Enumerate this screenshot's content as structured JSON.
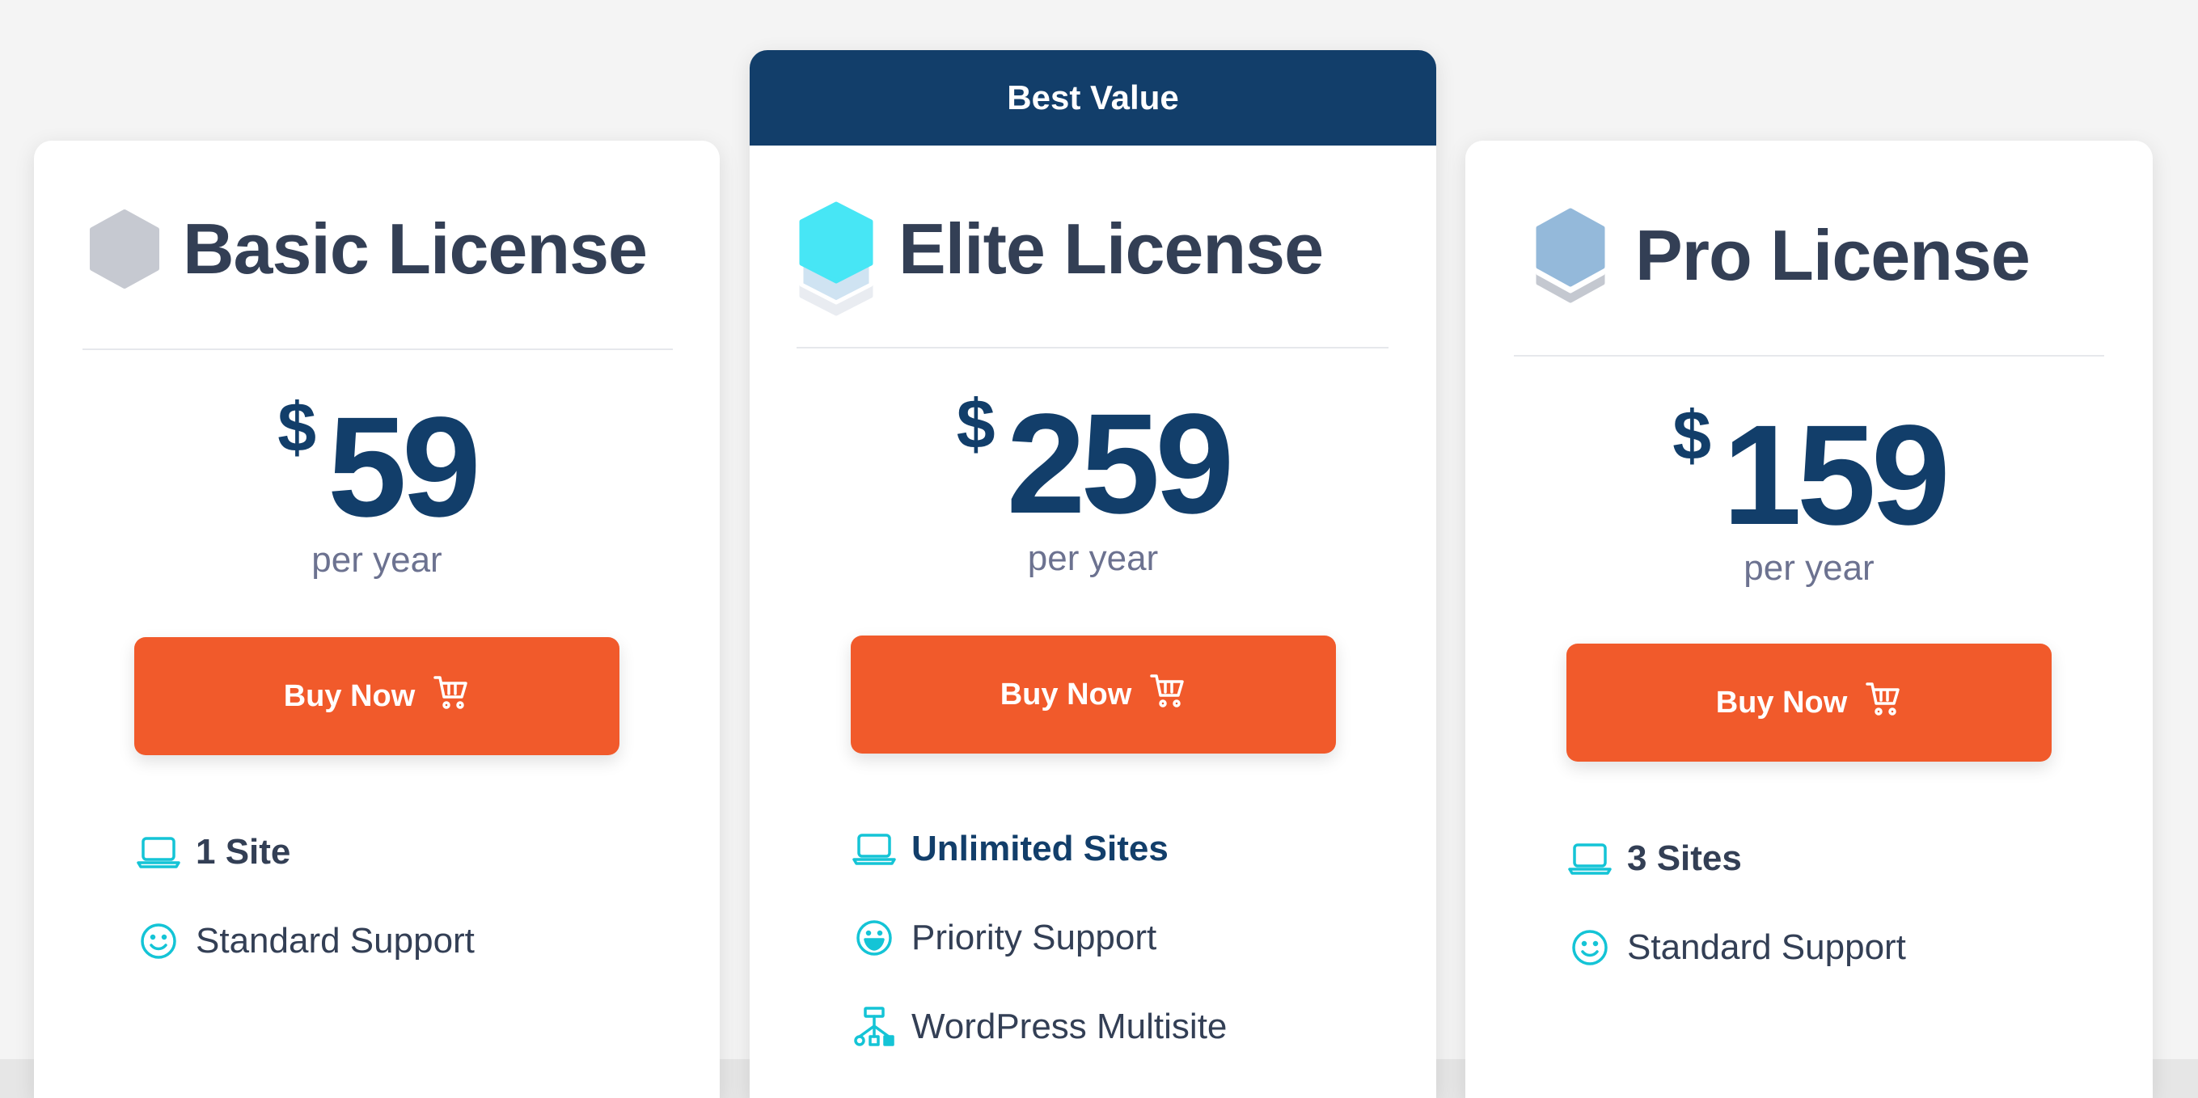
{
  "plans": [
    {
      "id": "basic",
      "name": "Basic License",
      "currency": "$",
      "price": "59",
      "period": "per year",
      "button": "Buy Now",
      "icon": "hexagon-gray-icon",
      "features": [
        {
          "icon": "laptop-icon",
          "text": "1 Site"
        },
        {
          "icon": "smile-icon",
          "text": "Standard Support"
        }
      ]
    },
    {
      "id": "elite",
      "badge": "Best Value",
      "name": "Elite License",
      "currency": "$",
      "price": "259",
      "period": "per year",
      "button": "Buy Now",
      "icon": "hexagon-stack-cyan-icon",
      "features": [
        {
          "icon": "laptop-icon",
          "text": "Unlimited Sites"
        },
        {
          "icon": "grin-icon",
          "text": "Priority Support"
        },
        {
          "icon": "network-icon",
          "text": "WordPress Multisite"
        }
      ]
    },
    {
      "id": "pro",
      "name": "Pro License",
      "currency": "$",
      "price": "159",
      "period": "per year",
      "button": "Buy Now",
      "icon": "hexagon-stack-blue-icon",
      "features": [
        {
          "icon": "laptop-icon",
          "text": "3 Sites"
        },
        {
          "icon": "smile-icon",
          "text": "Standard Support"
        }
      ]
    }
  ],
  "colors": {
    "accent_orange": "#f15a2b",
    "navy": "#123e6a",
    "text_dark": "#333f55",
    "text_muted": "#6c7290",
    "icon_teal": "#14c4d6"
  }
}
